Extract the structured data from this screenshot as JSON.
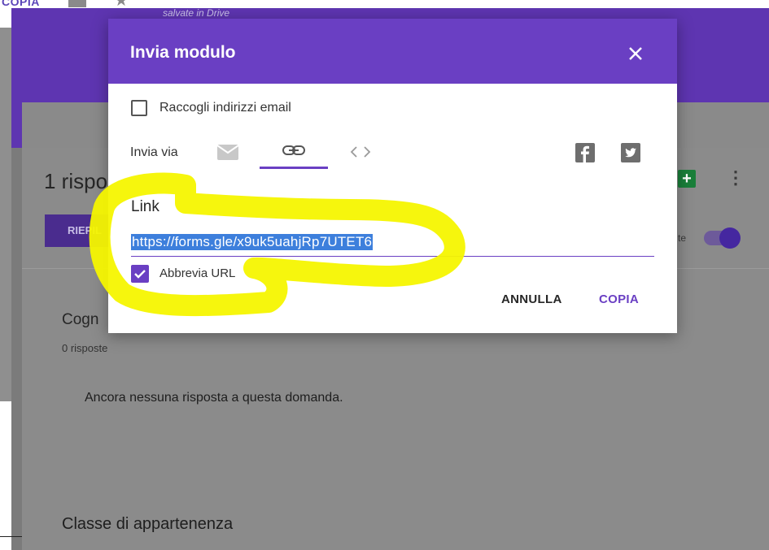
{
  "background": {
    "top_copy_label": "COPIA",
    "saved_status": "salvate in Drive",
    "responses_heading": "1 rispo",
    "summary_tab": "RIEPIL",
    "accept_responses_label": "te",
    "questions": [
      {
        "title": "Cogn",
        "count": "0 risposte",
        "empty_text": "Ancora nessuna risposta a questa domanda."
      },
      {
        "title": "Classe di appartenenza"
      }
    ]
  },
  "dialog": {
    "title": "Invia modulo",
    "collect_email_label": "Raccogli indirizzi email",
    "send_via_label": "Invia via",
    "link_heading": "Link",
    "link_value": "https://forms.gle/x9uk5uahjRp7UTET6",
    "shorten_url_label": "Abbrevia URL",
    "cancel_label": "ANNULLA",
    "copy_label": "COPIA"
  },
  "colors": {
    "accent": "#6a3fc3",
    "selection": "#3d7fdc",
    "highlighter": "#f5f500"
  },
  "icons": [
    "close-icon",
    "email-icon",
    "link-icon",
    "embed-code-icon",
    "facebook-icon",
    "twitter-icon",
    "sheets-icon",
    "more-vert-icon",
    "check-icon"
  ]
}
